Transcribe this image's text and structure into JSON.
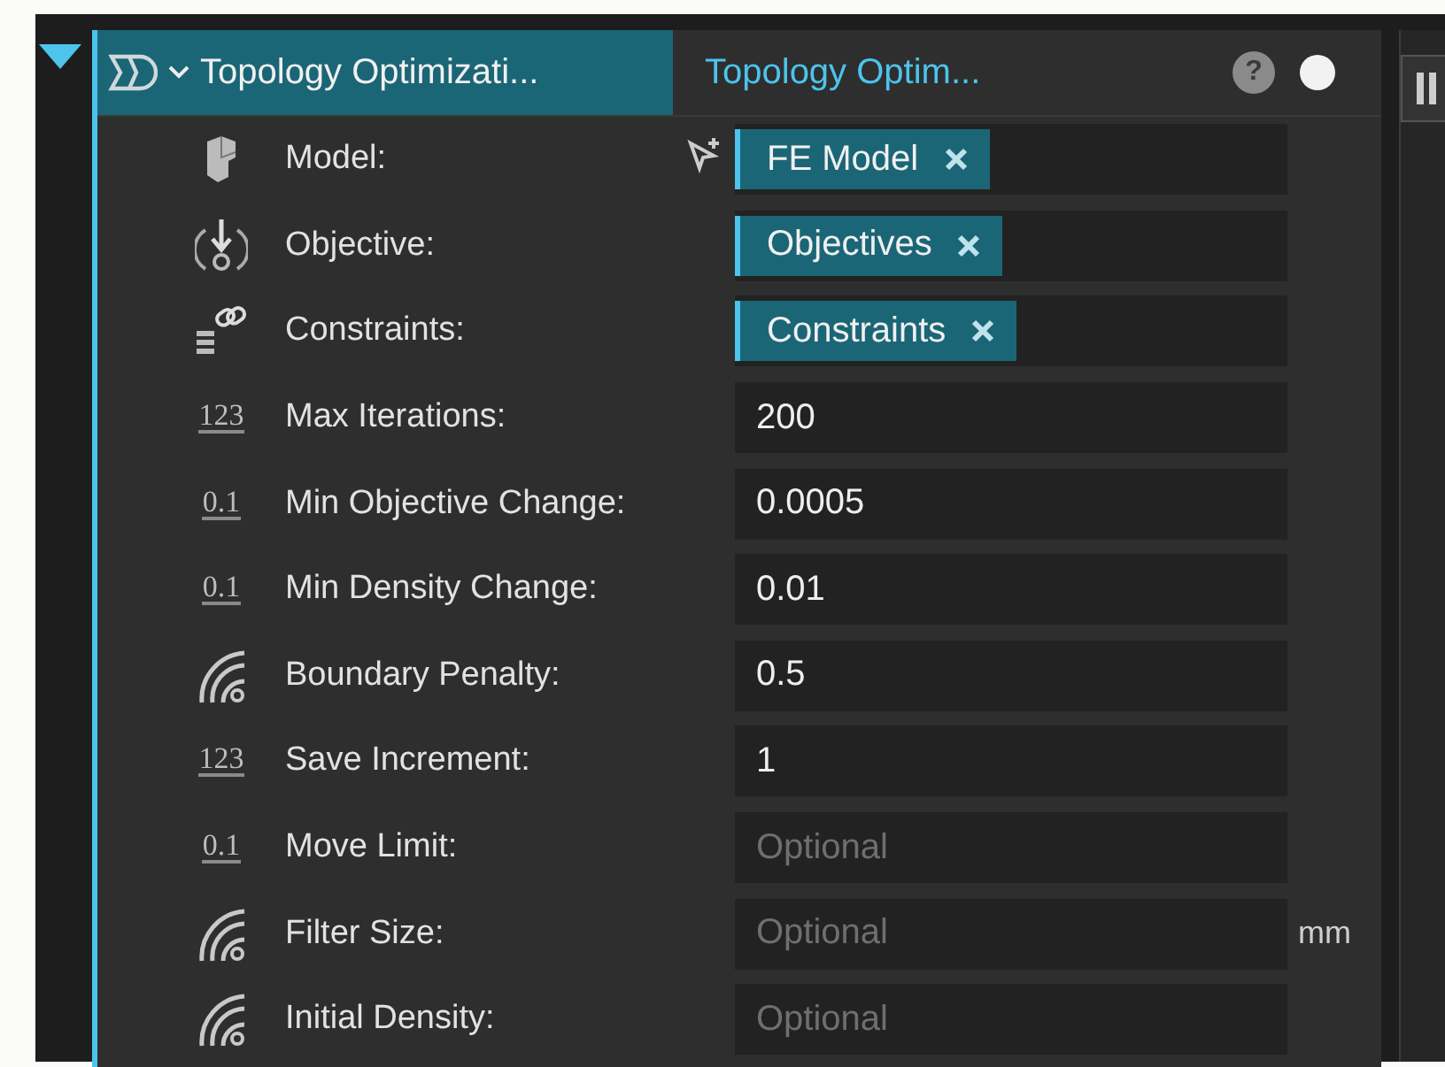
{
  "tabs": [
    {
      "label": "Topology Optimizati...",
      "selected": true
    },
    {
      "label": "Topology Optim...",
      "selected": false
    }
  ],
  "help": "?",
  "rows": [
    {
      "label": "Model:",
      "kind": "reference",
      "chip": "FE Model"
    },
    {
      "label": "Objective:",
      "kind": "reference",
      "chip": "Objectives"
    },
    {
      "label": "Constraints:",
      "kind": "reference",
      "chip": "Constraints"
    },
    {
      "icon_text": "123",
      "label": "Max Iterations:",
      "kind": "value",
      "value": "200"
    },
    {
      "icon_text": "0.1",
      "label": "Min Objective Change:",
      "kind": "value",
      "value": "0.0005"
    },
    {
      "icon_text": "0.1",
      "label": "Min Density Change:",
      "kind": "value",
      "value": "0.01"
    },
    {
      "label": "Boundary Penalty:",
      "kind": "value",
      "value": "0.5"
    },
    {
      "icon_text": "123",
      "label": "Save Increment:",
      "kind": "value",
      "value": "1"
    },
    {
      "icon_text": "0.1",
      "label": "Move Limit:",
      "kind": "value",
      "placeholder": "Optional"
    },
    {
      "label": "Filter Size:",
      "kind": "value",
      "placeholder": "Optional",
      "unit": "mm"
    },
    {
      "label": "Initial Density:",
      "kind": "value",
      "placeholder": "Optional"
    }
  ]
}
